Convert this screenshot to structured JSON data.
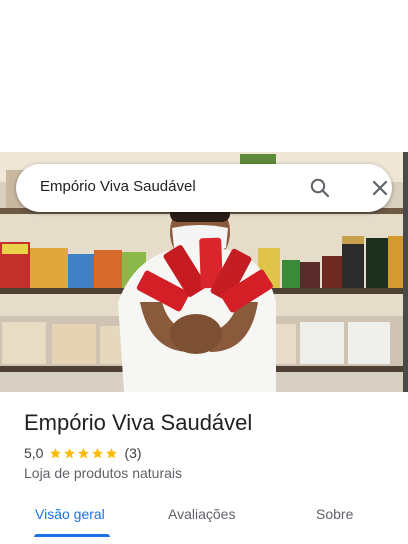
{
  "search": {
    "query": "Empório Viva Saudável",
    "icons": {
      "search": "search-icon",
      "close": "close-icon"
    }
  },
  "place": {
    "name": "Empório Viva Saudável",
    "rating": "5,0",
    "stars": 5,
    "review_count": "(3)",
    "category": "Loja de produtos naturais"
  },
  "tabs": [
    {
      "label": "Visão geral",
      "active": true
    },
    {
      "label": "Avaliações",
      "active": false
    },
    {
      "label": "Sobre",
      "active": false
    }
  ],
  "colors": {
    "accent": "#1a73e8",
    "star": "#fbbc04",
    "title": "#202124",
    "secondary": "#5f6368"
  }
}
